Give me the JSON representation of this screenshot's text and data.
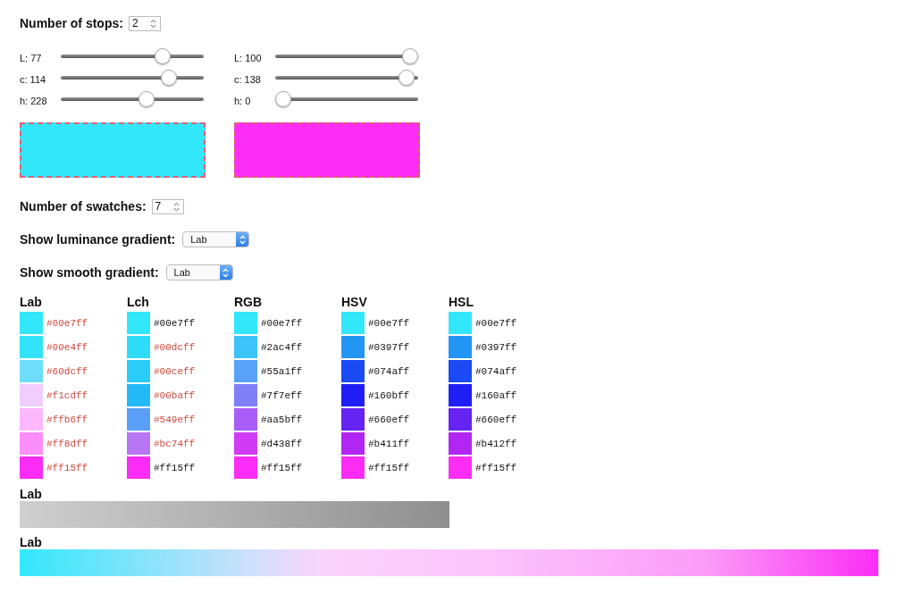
{
  "stops_control": {
    "label": "Number of stops:",
    "value": "2"
  },
  "stops": [
    {
      "color": "#33e7fa",
      "sliders": [
        {
          "label": "L: 77",
          "level": 0.74
        },
        {
          "label": "c: 114",
          "level": 0.79
        },
        {
          "label": "h: 228",
          "level": 0.61
        }
      ]
    },
    {
      "color": "#fb2cf5",
      "sliders": [
        {
          "label": "L: 100",
          "level": 1.0
        },
        {
          "label": "c: 138",
          "level": 0.97
        },
        {
          "label": "h: 0",
          "level": 0.0
        }
      ]
    }
  ],
  "swatches_control": {
    "label": "Number of swatches:",
    "value": "7"
  },
  "luminance_control": {
    "label": "Show luminance gradient:",
    "value": "Lab"
  },
  "smooth_control": {
    "label": "Show smooth gradient:",
    "value": "Lab"
  },
  "palettes": [
    {
      "title": "Lab",
      "swatches": [
        {
          "hex": "#00e7ff",
          "color": "#33e7fa",
          "clipped": true
        },
        {
          "hex": "#00e4ff",
          "color": "#33e2f8",
          "clipped": true
        },
        {
          "hex": "#60dcff",
          "color": "#6edcfb",
          "clipped": true
        },
        {
          "hex": "#f1cdff",
          "color": "#efcdfd",
          "clipped": true
        },
        {
          "hex": "#ffb6ff",
          "color": "#fdb7fd",
          "clipped": true
        },
        {
          "hex": "#ff8dff",
          "color": "#fb8ef8",
          "clipped": true
        },
        {
          "hex": "#ff15ff",
          "color": "#fb2cf5",
          "clipped": true
        }
      ]
    },
    {
      "title": "Lch",
      "swatches": [
        {
          "hex": "#00e7ff",
          "color": "#33e7fa",
          "clipped": false
        },
        {
          "hex": "#00dcff",
          "color": "#2fdcf8",
          "clipped": true
        },
        {
          "hex": "#00ceff",
          "color": "#2acdf7",
          "clipped": true
        },
        {
          "hex": "#00baff",
          "color": "#22b9f6",
          "clipped": true
        },
        {
          "hex": "#549eff",
          "color": "#5a9ff7",
          "clipped": true
        },
        {
          "hex": "#bc74ff",
          "color": "#b876f4",
          "clipped": true
        },
        {
          "hex": "#ff15ff",
          "color": "#fb2cf5",
          "clipped": false
        }
      ]
    },
    {
      "title": "RGB",
      "swatches": [
        {
          "hex": "#00e7ff",
          "color": "#33e7fa",
          "clipped": false
        },
        {
          "hex": "#2ac4ff",
          "color": "#3cc4f9",
          "clipped": false
        },
        {
          "hex": "#55a1ff",
          "color": "#5aa2f9",
          "clipped": false
        },
        {
          "hex": "#7f7eff",
          "color": "#7f80f8",
          "clipped": false
        },
        {
          "hex": "#aa5bff",
          "color": "#a95df7",
          "clipped": false
        },
        {
          "hex": "#d438ff",
          "color": "#d03cf6",
          "clipped": false
        },
        {
          "hex": "#ff15ff",
          "color": "#fb2cf5",
          "clipped": false
        }
      ]
    },
    {
      "title": "HSV",
      "swatches": [
        {
          "hex": "#00e7ff",
          "color": "#33e7fa",
          "clipped": false
        },
        {
          "hex": "#0397ff",
          "color": "#2295f5",
          "clipped": false
        },
        {
          "hex": "#074aff",
          "color": "#1b4bf5",
          "clipped": false
        },
        {
          "hex": "#160bff",
          "color": "#1f1ff5",
          "clipped": false
        },
        {
          "hex": "#660eff",
          "color": "#6524f2",
          "clipped": false
        },
        {
          "hex": "#b411ff",
          "color": "#b126f3",
          "clipped": false
        },
        {
          "hex": "#ff15ff",
          "color": "#fb2cf5",
          "clipped": false
        }
      ]
    },
    {
      "title": "HSL",
      "swatches": [
        {
          "hex": "#00e7ff",
          "color": "#33e7fa",
          "clipped": false
        },
        {
          "hex": "#0397ff",
          "color": "#2295f5",
          "clipped": false
        },
        {
          "hex": "#074aff",
          "color": "#1b4bf5",
          "clipped": false
        },
        {
          "hex": "#160aff",
          "color": "#1f1ff5",
          "clipped": false
        },
        {
          "hex": "#660eff",
          "color": "#6524f2",
          "clipped": false
        },
        {
          "hex": "#b412ff",
          "color": "#b126f3",
          "clipped": false
        },
        {
          "hex": "#ff15ff",
          "color": "#fb2cf5",
          "clipped": false
        }
      ]
    }
  ],
  "luminance_gradient": {
    "title": "Lab"
  },
  "smooth_gradient": {
    "title": "Lab"
  }
}
